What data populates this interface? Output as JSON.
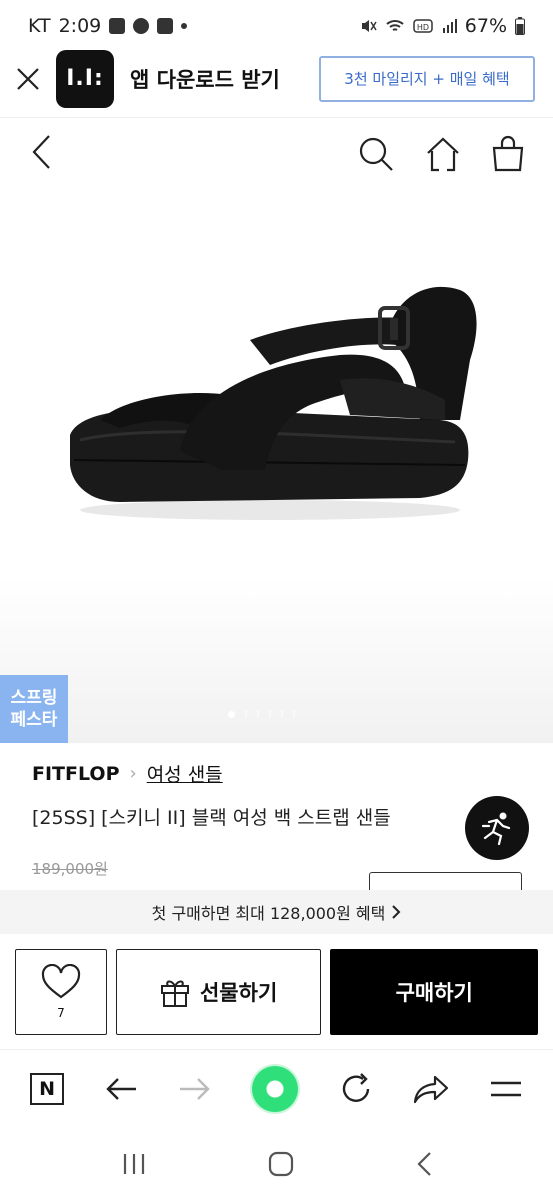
{
  "status_bar": {
    "carrier": "KT",
    "time": "2:09",
    "battery": "67%"
  },
  "app_banner": {
    "logo_text": "I.I:",
    "title": "앱 다운로드 받기",
    "mileage_button": "3천 마일리지 + 매일 혜택"
  },
  "product": {
    "brand": "FITFLOP",
    "category": "여성 샌들",
    "name": "[25SS] [스키니 II] 블랙 여성 백 스트랩 샌들",
    "original_price": "189,000원",
    "promo_badge": [
      "스프링",
      "페스타"
    ]
  },
  "carousel": {
    "total": 6,
    "current": 1
  },
  "benefit_bar": {
    "text": "첫 구매하면 최대 128,000원 혜택"
  },
  "actions": {
    "like_count": "7",
    "gift_label": "선물하기",
    "buy_label": "구매하기"
  },
  "browser_bar": {
    "n_label": "N"
  },
  "colors": {
    "accent_blue": "#3a6cc8",
    "promo_badge": "#8ab4f0",
    "green": "#2fe07a"
  }
}
